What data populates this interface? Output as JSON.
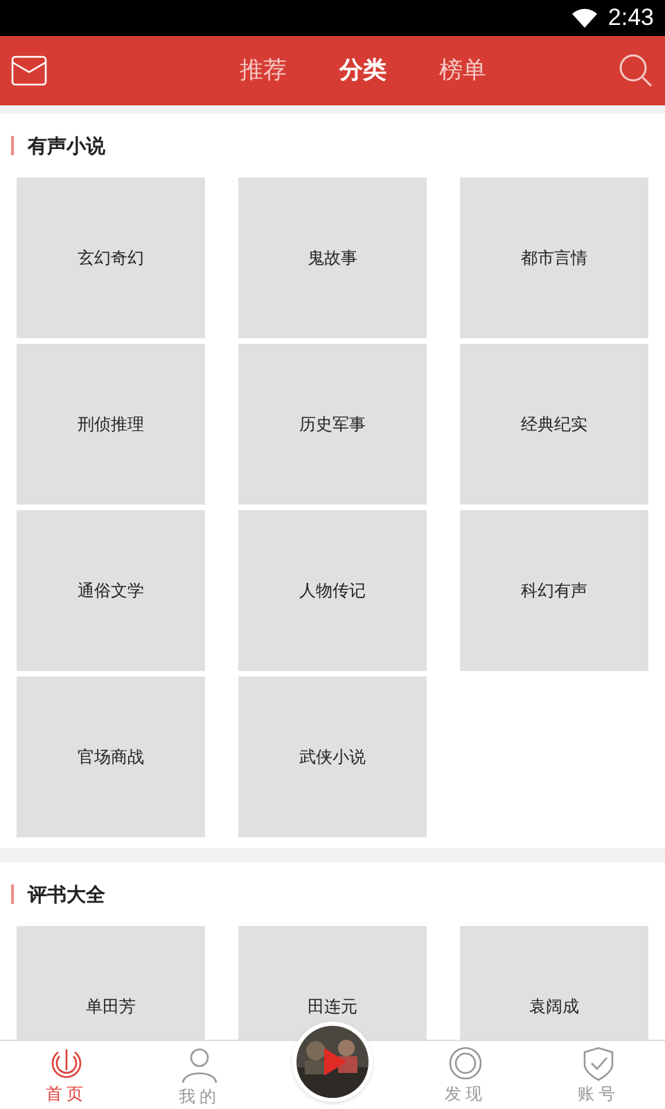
{
  "status_bar": {
    "time": "2:43"
  },
  "header": {
    "tabs": [
      {
        "label": "推荐",
        "selected": false
      },
      {
        "label": "分类",
        "selected": true
      },
      {
        "label": "榜单",
        "selected": false
      }
    ]
  },
  "sections": [
    {
      "title": "有声小说",
      "items": [
        "玄幻奇幻",
        "鬼故事",
        "都市言情",
        "刑侦推理",
        "历史军事",
        "经典纪实",
        "通俗文学",
        "人物传记",
        "科幻有声",
        "官场商战",
        "武侠小说"
      ]
    },
    {
      "title": "评书大全",
      "items": [
        "单田芳",
        "田连元",
        "袁阔成"
      ]
    }
  ],
  "bottom_nav": {
    "items": [
      {
        "label": "首页",
        "kind": "home",
        "selected": true
      },
      {
        "label": "我的",
        "kind": "person",
        "selected": false
      },
      {
        "kind": "player",
        "selected": false
      },
      {
        "label": "发现",
        "kind": "discover",
        "selected": false
      },
      {
        "label": "账号",
        "kind": "shield",
        "selected": false
      }
    ]
  }
}
